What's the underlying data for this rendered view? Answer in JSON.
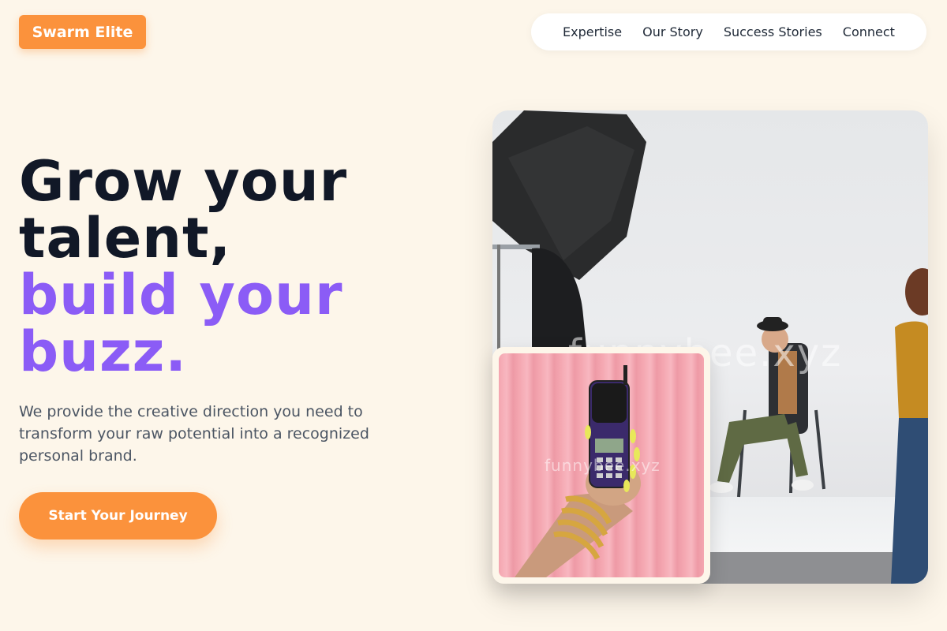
{
  "brand": {
    "name": "Swarm Elite"
  },
  "nav": {
    "items": [
      {
        "label": "Expertise"
      },
      {
        "label": "Our Story"
      },
      {
        "label": "Success Stories"
      },
      {
        "label": "Connect"
      }
    ]
  },
  "hero": {
    "title_line1": "Grow your",
    "title_line2": "talent,",
    "title_line3": "build your",
    "title_line4": "buzz.",
    "description": "We provide the creative direction you need to transform your raw potential into a recognized personal brand.",
    "cta_label": "Start Your Journey"
  },
  "images": {
    "main_watermark": "funnybee.xyz",
    "inset_watermark": "funnybee.xyz"
  },
  "colors": {
    "accent_orange": "#fb923c",
    "accent_purple": "#8b5cf6",
    "background": "#fdf6ea",
    "heading_dark": "#111827"
  }
}
